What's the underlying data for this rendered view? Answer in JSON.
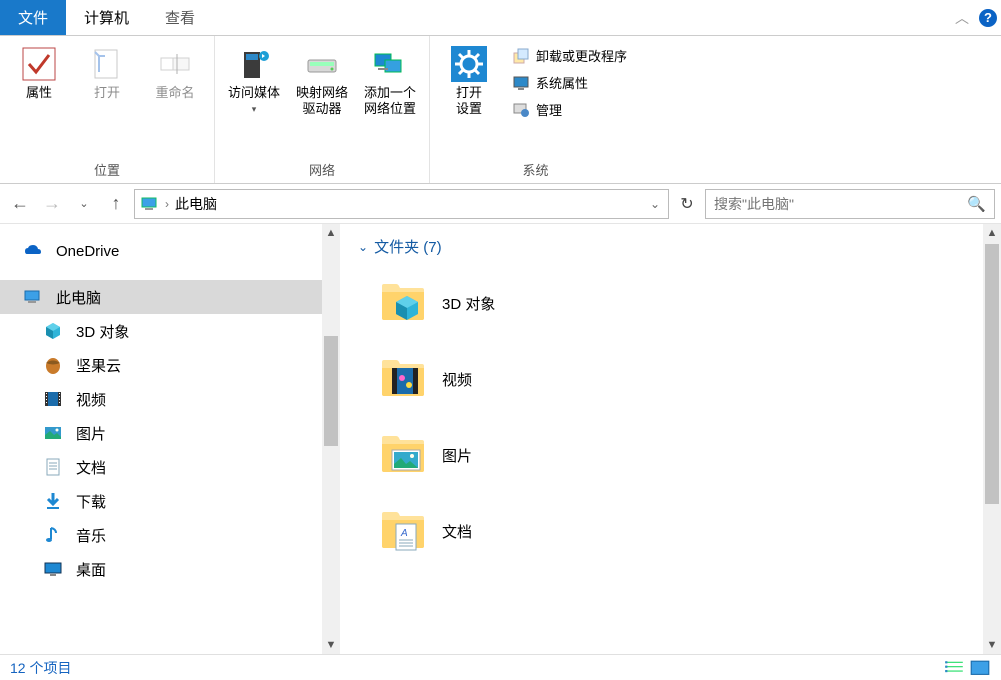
{
  "tabs": {
    "file": "文件",
    "computer": "计算机",
    "view": "查看"
  },
  "ribbon": {
    "location": {
      "properties": "属性",
      "open": "打开",
      "rename": "重命名",
      "group": "位置"
    },
    "network": {
      "media": "访问媒体",
      "map": "映射网络\n驱动器",
      "addloc": "添加一个\n网络位置",
      "group": "网络"
    },
    "system": {
      "openset": "打开\n设置",
      "uninstall": "卸载或更改程序",
      "sysprops": "系统属性",
      "manage": "管理",
      "group": "系统"
    }
  },
  "nav": {
    "address": "此电脑",
    "searchPlaceholder": "搜索\"此电脑\""
  },
  "sidebar": {
    "items": [
      {
        "label": "OneDrive",
        "icon": "onedrive",
        "level": 1
      },
      {
        "label": "此电脑",
        "icon": "pc",
        "level": 1,
        "selected": true
      },
      {
        "label": "3D 对象",
        "icon": "cube",
        "level": 2
      },
      {
        "label": "坚果云",
        "icon": "nut",
        "level": 2
      },
      {
        "label": "视频",
        "icon": "video",
        "level": 2
      },
      {
        "label": "图片",
        "icon": "picture",
        "level": 2
      },
      {
        "label": "文档",
        "icon": "document",
        "level": 2
      },
      {
        "label": "下载",
        "icon": "download",
        "level": 2
      },
      {
        "label": "音乐",
        "icon": "music",
        "level": 2
      },
      {
        "label": "桌面",
        "icon": "desktop",
        "level": 2
      }
    ]
  },
  "content": {
    "groupHeader": "文件夹 (7)",
    "folders": [
      {
        "label": "3D 对象",
        "icon": "cube"
      },
      {
        "label": "视频",
        "icon": "video"
      },
      {
        "label": "图片",
        "icon": "picture"
      },
      {
        "label": "文档",
        "icon": "document"
      }
    ]
  },
  "status": {
    "text": "12 个项目"
  }
}
